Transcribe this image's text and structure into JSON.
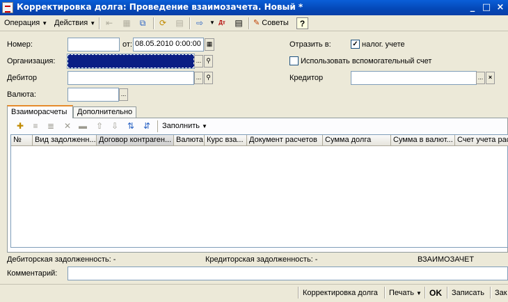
{
  "window": {
    "title": "Корректировка долга: Проведение взаимозачета. Новый *",
    "minimize_glyph": "_",
    "maximize_glyph": "□",
    "close_glyph": "×"
  },
  "toolbar": {
    "operation_label": "Операция",
    "actions_label": "Действия",
    "advice_label": "Советы",
    "help_label": "?"
  },
  "form": {
    "number_label": "Номер:",
    "number_value": "",
    "date_prefix": "от:",
    "date_value": "08.05.2010  0:00:00",
    "organization_label": "Организация:",
    "organization_value": "",
    "debtor_label": "Дебитор",
    "debtor_value": "",
    "currency_label": "Валюта:",
    "currency_value": "",
    "reflect_in_label": "Отразить в:",
    "tax_accounting_label": "налог. учете",
    "tax_accounting_checked": true,
    "aux_account_label": "Использовать вспомогательный счет",
    "aux_account_checked": false,
    "creditor_label": "Кредитор",
    "creditor_value": ""
  },
  "tabs": [
    {
      "label": "Взаиморасчеты"
    },
    {
      "label": "Дополнительно"
    }
  ],
  "grid_toolbar": {
    "fill_label": "Заполнить"
  },
  "grid": {
    "columns": [
      "№",
      "Вид задолженн...",
      "Договор контраген...",
      "Валюта",
      "Курс вза...",
      "Документ расчетов",
      "Сумма долга",
      "Сумма в валют...",
      "Счет учета расч"
    ],
    "rows": []
  },
  "summary": {
    "debit_label": "Дебиторская задолженность: -",
    "credit_label": "Кредиторская задолженность: -",
    "operation_type": "ВЗАИМОЗАЧЕТ"
  },
  "comment": {
    "label": "Комментарий:",
    "value": ""
  },
  "bottom": {
    "debt_adjustment_label": "Корректировка долга",
    "print_label": "Печать",
    "ok_label": "OK",
    "save_label": "Записать",
    "close_label": "Зак"
  }
}
